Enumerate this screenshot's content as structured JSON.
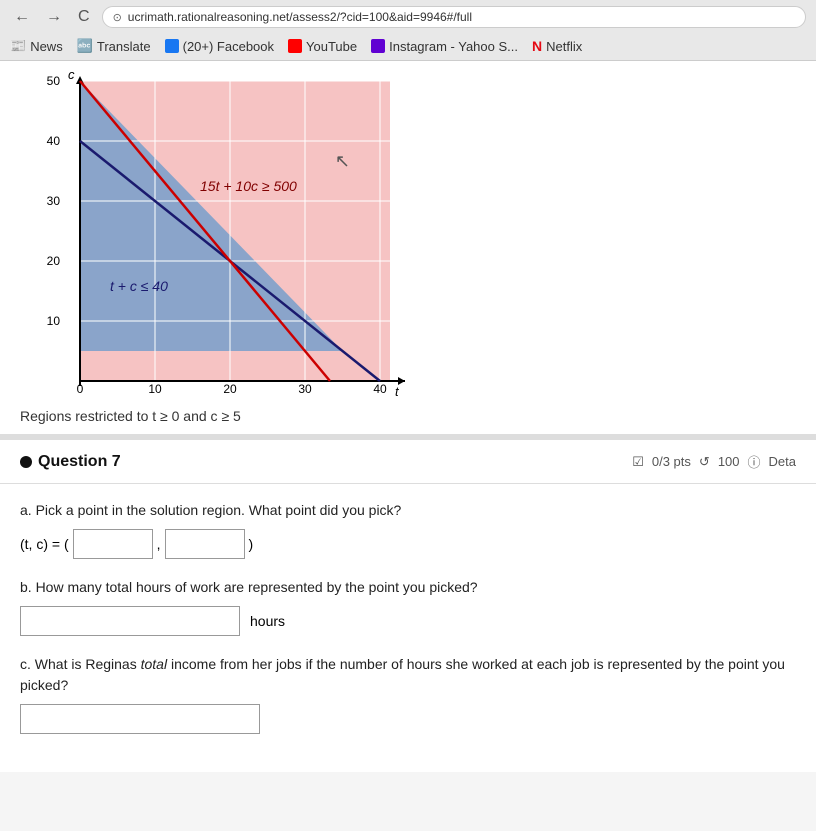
{
  "browser": {
    "back": "←",
    "forward": "→",
    "refresh": "C",
    "url": "ucrimath.rationalreasoning.net/assess2/?cid=100&aid=9946#/full",
    "bookmarks": [
      {
        "label": "News",
        "icon": "news"
      },
      {
        "label": "Translate",
        "icon": "translate"
      },
      {
        "label": "(20+) Facebook",
        "icon": "facebook"
      },
      {
        "label": "YouTube",
        "icon": "youtube"
      },
      {
        "label": "Instagram - Yahoo S...",
        "icon": "yahoo"
      },
      {
        "label": "Netflix",
        "icon": "netflix"
      }
    ]
  },
  "graph": {
    "inequality1": "15t + 10c ≥ 500",
    "inequality2": "t + c ≤ 40",
    "caption": "Regions restricted to t ≥ 0 and c ≥ 5"
  },
  "question": {
    "number": "Question 7",
    "dot": "●",
    "pts": "0/3 pts",
    "timer": "100",
    "details": "Deta",
    "sub_a_label": "a. Pick a point in the solution region. What point did you pick?",
    "sub_a_prefix": "(t, c) = (",
    "sub_a_comma": ",",
    "sub_a_suffix": ")",
    "sub_b_label": "b. How many total hours of work are represented by the point you picked?",
    "sub_b_suffix": "hours",
    "sub_c_label": "c. What is Reginas total income from her jobs if the number of hours she worked at each job is represented by the point you picked?",
    "sub_c_italic": "total"
  }
}
